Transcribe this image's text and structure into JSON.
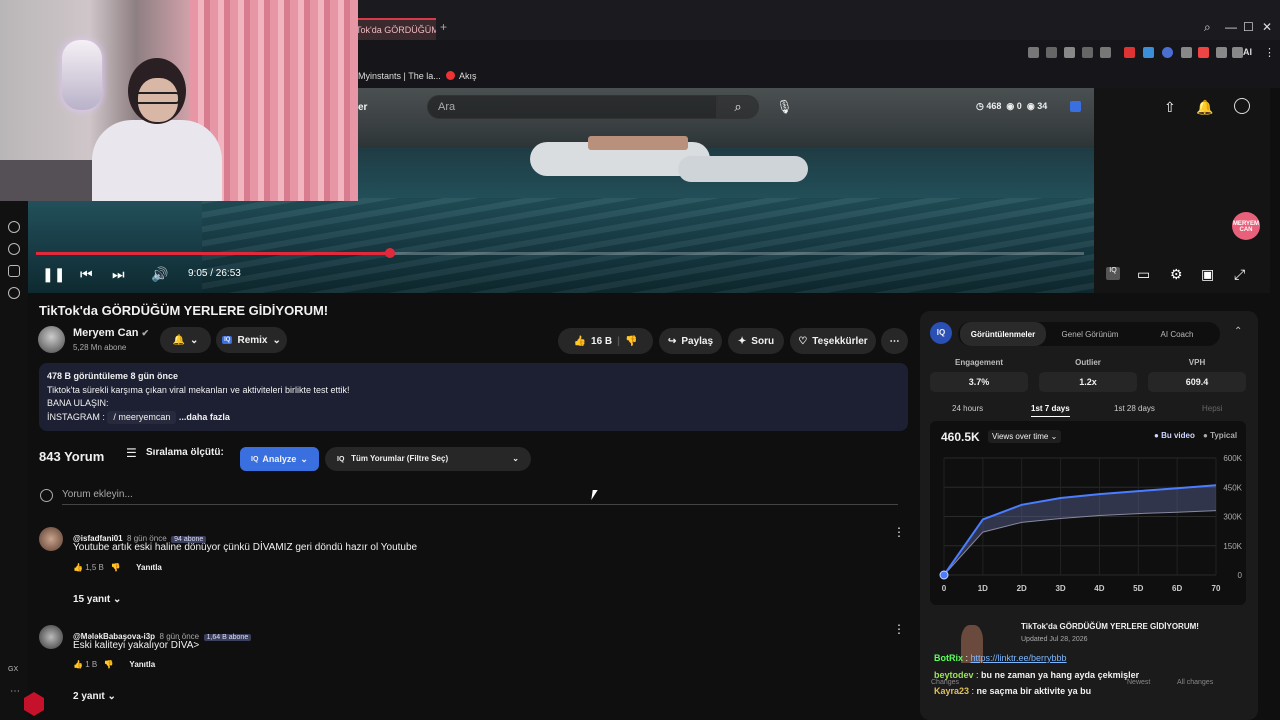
{
  "browser": {
    "tab_title": "Tok'da GÖRDÜĞÜM",
    "tab_plus": "+",
    "bookmarks": [
      "Myinstants | The la...",
      "Akış"
    ],
    "toolbar_ai": "AI",
    "sidebar_bottom_label": "GX"
  },
  "header": {
    "logo_fragment": "er",
    "search_placeholder": "Ara",
    "stats": {
      "clock": "468",
      "eye1": "0",
      "eye2": "34"
    }
  },
  "player": {
    "time": "9:05 / 26:53",
    "progress_fraction": 0.3378,
    "channel_watermark": "MERYEM CAN"
  },
  "video": {
    "title": "TikTok'da GÖRDÜĞÜM YERLERE GİDİYORUM!",
    "channel": "Meryem Can",
    "subs": "5,28 Mn abone",
    "remix": "Remix",
    "likes": "16 B",
    "share": "Paylaş",
    "ask": "Soru",
    "thanks": "Teşekkürler"
  },
  "description": {
    "meta": "478 B görüntüleme  8 gün önce",
    "line1": "Tiktok'ta sürekli karşıma çıkan viral mekanları ve aktiviteleri birlikte test ettik!",
    "line2": "BANA ULAŞIN:",
    "insta_label": "İNSTAGRAM :",
    "insta_handle": "/ meeryemcan",
    "more": "...daha fazla"
  },
  "comments": {
    "count": "843 Yorum",
    "sort_label": "Sıralama ölçütü:",
    "analyze": "Analyze",
    "filter": "Tüm Yorumlar (Filtre Seç)",
    "add_placeholder": "Yorum ekleyin...",
    "items": [
      {
        "user": "@isfadfani01",
        "time": "8 gün önce",
        "tag": "94 abone",
        "text": "Youtube artık eski haline dönüyor çünkü DİVAMIZ geri döndü hazır ol Youtube",
        "likes": "1,5 B",
        "reply": "Yanıtla",
        "replies": "15 yanıt"
      },
      {
        "user": "@MələkBabaşova-i3p",
        "time": "8 gün önce",
        "tag": "1,64 B abone",
        "text": "Eski kaliteyi yakalıyor DİVA>",
        "likes": "1 B",
        "reply": "Yanıtla",
        "replies": "2 yanıt"
      }
    ]
  },
  "panel": {
    "tabs": [
      "Görüntülenmeler",
      "Genel Görünüm",
      "AI Coach"
    ],
    "metrics": [
      {
        "label": "Engagement",
        "value": "3.7%"
      },
      {
        "label": "Outlier",
        "value": "1.2x"
      },
      {
        "label": "VPH",
        "value": "609.4"
      }
    ],
    "ranges": [
      "24 hours",
      "1st 7 days",
      "1st 28 days",
      "Hepsi"
    ],
    "views": "460.5K",
    "views_dropdown": "Views over time",
    "legend_this": "Bu video",
    "legend_typical": "Typical",
    "related_title": "TikTok'da GÖRDÜĞÜM YERLERE GİDİYORUM!",
    "related_date": "Updated Jul 28, 2026"
  },
  "chart_data": {
    "type": "line",
    "x": [
      0,
      1,
      2,
      3,
      4,
      5,
      6,
      7
    ],
    "x_tick_labels": [
      "0",
      "1D",
      "2D",
      "3D",
      "4D",
      "5D",
      "6D",
      "70"
    ],
    "y_tick_labels": [
      "0",
      "150K",
      "300K",
      "450K",
      "600K"
    ],
    "ylim": [
      0,
      600000
    ],
    "series": [
      {
        "name": "Bu video",
        "values": [
          0,
          285000,
          360000,
          395000,
          415000,
          430000,
          445000,
          460500
        ],
        "color": "#4a7dff"
      },
      {
        "name": "Typical",
        "values": [
          0,
          220000,
          270000,
          290000,
          305000,
          315000,
          322000,
          330000
        ],
        "color": "#8888a0"
      }
    ]
  },
  "chat": [
    {
      "name": "BotRix",
      "text": "https://linktr.ee/berrybbb",
      "color": "#5cff5c"
    },
    {
      "name": "beytodev",
      "text": "bu ne zaman ya hang ayda çekmişler",
      "color": "#9be35a"
    },
    {
      "name": "Kayra23",
      "text": "ne saçma bir aktivite ya bu",
      "color": "#e0c060"
    }
  ],
  "chat_bar": {
    "changes": "Changes",
    "newest": "Newest",
    "all_changes": "All changes"
  }
}
